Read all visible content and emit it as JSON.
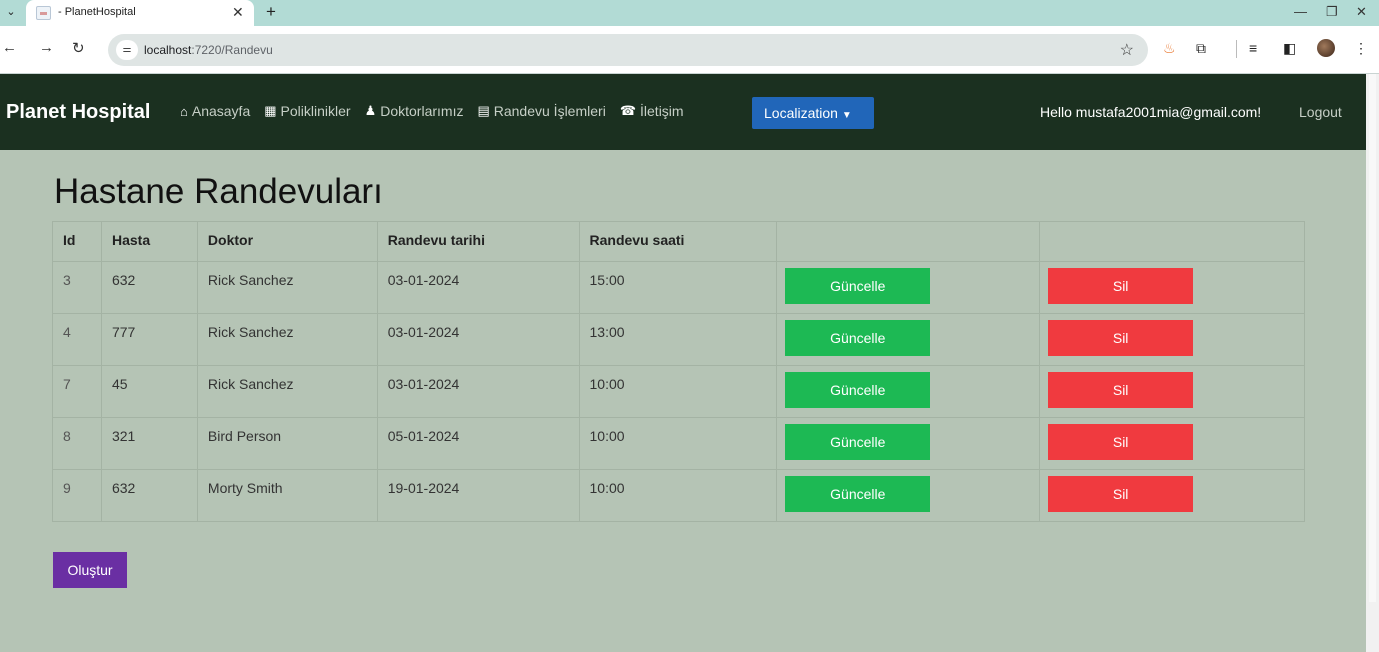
{
  "browser": {
    "tab_title": "- PlanetHospital",
    "url_host": "localhost",
    "url_path": ":7220/Randevu"
  },
  "navbar": {
    "brand": "Planet Hospital",
    "links": [
      {
        "label": "Anasayfa",
        "icon": "home-icon"
      },
      {
        "label": "Poliklinikler",
        "icon": "hospital-icon"
      },
      {
        "label": "Doktorlarımız",
        "icon": "doctor-icon"
      },
      {
        "label": "Randevu İşlemleri",
        "icon": "document-icon"
      },
      {
        "label": "İletişim",
        "icon": "phone-icon"
      }
    ],
    "localization_label": "Localization",
    "greeting": "Hello mustafa2001mia@gmail.com!",
    "logout_label": "Logout"
  },
  "main": {
    "title": "Hastane Randevuları",
    "table": {
      "headers": [
        "Id",
        "Hasta",
        "Doktor",
        "Randevu tarihi",
        "Randevu saati",
        "",
        ""
      ],
      "rows": [
        {
          "id": "3",
          "hasta": "632",
          "doktor": "Rick Sanchez",
          "tarih": "03-01-2024",
          "saat": "15:00"
        },
        {
          "id": "4",
          "hasta": "777",
          "doktor": "Rick Sanchez",
          "tarih": "03-01-2024",
          "saat": "13:00"
        },
        {
          "id": "7",
          "hasta": "45",
          "doktor": "Rick Sanchez",
          "tarih": "03-01-2024",
          "saat": "10:00"
        },
        {
          "id": "8",
          "hasta": "321",
          "doktor": "Bird Person",
          "tarih": "05-01-2024",
          "saat": "10:00"
        },
        {
          "id": "9",
          "hasta": "632",
          "doktor": "Morty Smith",
          "tarih": "19-01-2024",
          "saat": "10:00"
        }
      ]
    },
    "update_label": "Güncelle",
    "delete_label": "Sil",
    "create_label": "Oluştur"
  },
  "colors": {
    "page_bg": "#b5c4b5",
    "navbar_bg": "#1b3020",
    "update_btn": "#1db954",
    "delete_btn": "#f03a3f",
    "create_btn": "#6a2fa3",
    "localization_btn": "#2166b9"
  }
}
